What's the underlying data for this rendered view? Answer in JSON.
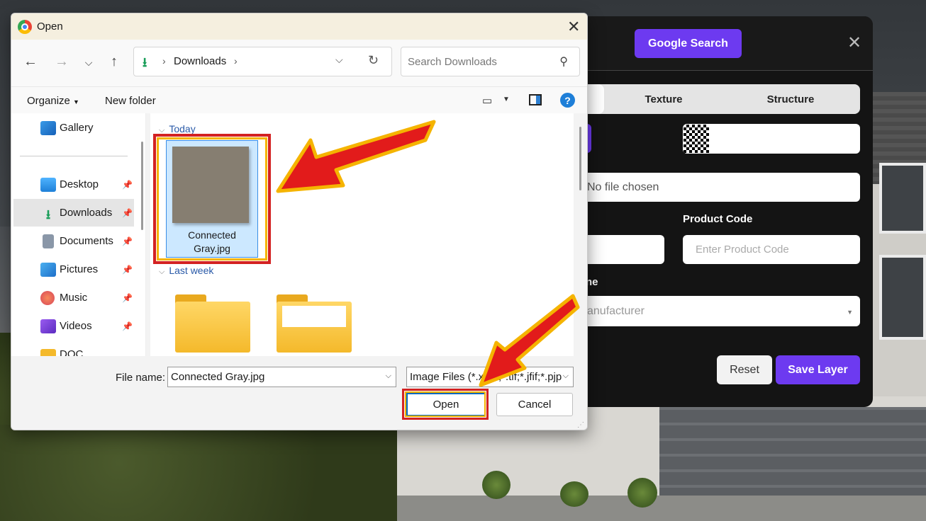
{
  "modal": {
    "google_search": "Google Search",
    "tabs": [
      "Texture",
      "Structure"
    ],
    "file_status": "No file chosen",
    "product_code_label": "Product Code",
    "product_code_placeholder": "Enter Product Code",
    "name_label_fragment": "ne",
    "manufacturer_placeholder_fragment": "anufacturer",
    "reset_label": "Reset",
    "save_label": "Save Layer"
  },
  "dialog": {
    "title": "Open",
    "address": {
      "folder": "Downloads"
    },
    "search_placeholder": "Search Downloads",
    "commands": {
      "organize": "Organize",
      "new_folder": "New folder"
    },
    "sidebar": [
      {
        "label": "Gallery",
        "icon": "gallery-icon",
        "pinned": false
      },
      {
        "label": "Desktop",
        "icon": "desktop-icon",
        "pinned": true
      },
      {
        "label": "Downloads",
        "icon": "downloads-icon",
        "pinned": true,
        "selected": true
      },
      {
        "label": "Documents",
        "icon": "documents-icon",
        "pinned": true
      },
      {
        "label": "Pictures",
        "icon": "pictures-icon",
        "pinned": true
      },
      {
        "label": "Music",
        "icon": "music-icon",
        "pinned": true
      },
      {
        "label": "Videos",
        "icon": "videos-icon",
        "pinned": true
      },
      {
        "label": "DOC",
        "icon": "folder-icon",
        "pinned": false
      }
    ],
    "groups": [
      {
        "label": "Today",
        "files": [
          {
            "name_line1": "Connected",
            "name_line2": "Gray.jpg",
            "selected": true
          }
        ]
      },
      {
        "label": "Last week",
        "files": [
          {
            "type": "folder"
          },
          {
            "type": "folder"
          }
        ]
      }
    ],
    "file_name_label": "File name:",
    "file_name_value": "Connected Gray.jpg",
    "file_type_value": "Image Files (*.xbm;*.tif;*.jfif;*.pjp",
    "open_label": "Open",
    "cancel_label": "Cancel"
  },
  "colors": {
    "accent_purple": "#6d3af0",
    "annotation_red": "#d32222",
    "annotation_yellow": "#f5b400",
    "selection_blue": "#cce8ff"
  }
}
